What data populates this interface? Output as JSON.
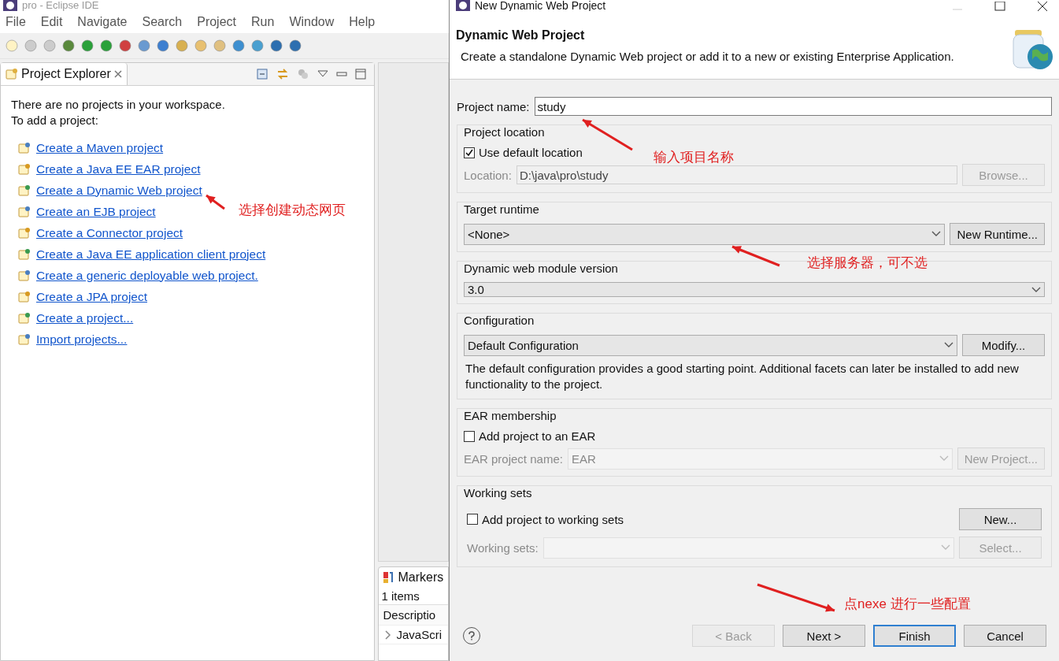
{
  "ide": {
    "title": "pro - Eclipse IDE",
    "menu": [
      "File",
      "Edit",
      "Navigate",
      "Search",
      "Project",
      "Run",
      "Window",
      "Help"
    ],
    "explorer": {
      "tab": "Project Explorer",
      "intro": [
        "There are no projects in your workspace.",
        "To add a project:"
      ],
      "links": [
        "Create a Maven project",
        "Create a Java EE EAR project",
        "Create a Dynamic Web project",
        "Create an EJB project",
        "Create a Connector project",
        "Create a Java EE application client project",
        "Create a generic deployable web project.",
        "Create a JPA project",
        "Create a project...",
        "Import projects..."
      ]
    },
    "markers": {
      "tab": "Markers",
      "count": "1 items",
      "column": "Descriptio",
      "row": "JavaScri"
    }
  },
  "dialog": {
    "title": "New Dynamic Web Project",
    "heading": "Dynamic Web Project",
    "description": "Create a standalone Dynamic Web project or add it to a new or existing Enterprise Application.",
    "project_name": {
      "label": "Project name:",
      "value": "study"
    },
    "location": {
      "group": "Project location",
      "checkbox": {
        "label": "Use default location",
        "checked": true
      },
      "label": "Location:",
      "value": "D:\\java\\pro\\study",
      "disabled": true,
      "button": {
        "label": "Browse...",
        "disabled": true
      }
    },
    "runtime": {
      "group": "Target runtime",
      "value": "<None>",
      "button": {
        "label": "New Runtime...",
        "disabled": false
      }
    },
    "module_version": {
      "group": "Dynamic web module version",
      "value": "3.0"
    },
    "configuration": {
      "group": "Configuration",
      "value": "Default Configuration",
      "button": {
        "label": "Modify...",
        "disabled": false
      },
      "note": "The default configuration provides a good starting point. Additional facets can later be installed to add new functionality to the project."
    },
    "ear": {
      "group": "EAR membership",
      "checkbox": {
        "label": "Add project to an EAR",
        "checked": false
      },
      "label": "EAR project name:",
      "value": "EAR",
      "disabled": true,
      "button": {
        "label": "New Project...",
        "disabled": true
      }
    },
    "working_sets": {
      "group": "Working sets",
      "checkbox": {
        "label": "Add project to working sets",
        "checked": false
      },
      "new_button": {
        "label": "New...",
        "disabled": false
      },
      "label": "Working sets:",
      "disabled": true,
      "button": {
        "label": "Select...",
        "disabled": true
      }
    },
    "footer": [
      {
        "label": "< Back",
        "disabled": true,
        "default": false
      },
      {
        "label": "Next >",
        "disabled": false,
        "default": false
      },
      {
        "label": "Finish",
        "disabled": false,
        "default": true
      },
      {
        "label": "Cancel",
        "disabled": false,
        "default": false
      }
    ]
  },
  "annotations": [
    {
      "text": "选择创建动态网页"
    },
    {
      "text": "输入项目名称"
    },
    {
      "text": "选择服务器，可不选"
    },
    {
      "text": "点nexe 进行一些配置"
    }
  ]
}
